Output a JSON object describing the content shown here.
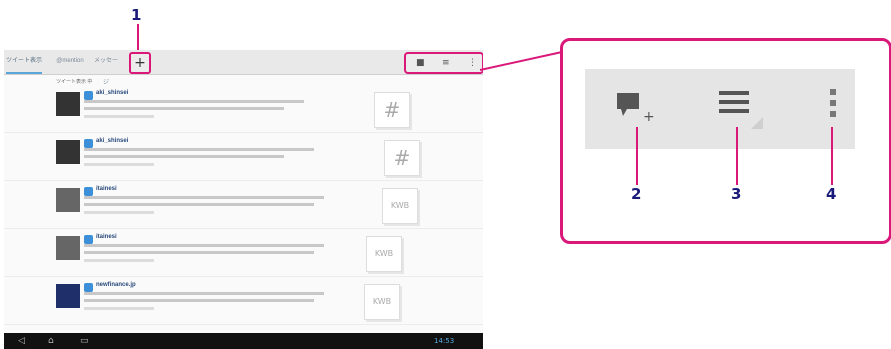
{
  "callouts": {
    "c1": "1",
    "c2": "2",
    "c3": "3",
    "c4": "4"
  },
  "tabs": [
    {
      "label": "ツイート表示"
    },
    {
      "label": "@mention"
    },
    {
      "label": "メッセージ"
    }
  ],
  "list_header": "ツイート表示 中",
  "tweets": [
    {
      "user": "aki_shinsei",
      "thumb": "#"
    },
    {
      "user": "aki_shinsei",
      "thumb": "#"
    },
    {
      "user": "itainesi",
      "thumb": "KWB"
    },
    {
      "user": "itainesi",
      "thumb": "KWB"
    },
    {
      "user": "newfinance.jp",
      "thumb": "KWB"
    }
  ],
  "status": {
    "time": "14:53"
  },
  "colors": {
    "callout": "#d9187a",
    "accent": "#5aa6d8",
    "nav": "#111111"
  },
  "icons": [
    "add-tab-icon",
    "new-tweet-icon",
    "menu-list-icon",
    "overflow-icon"
  ]
}
